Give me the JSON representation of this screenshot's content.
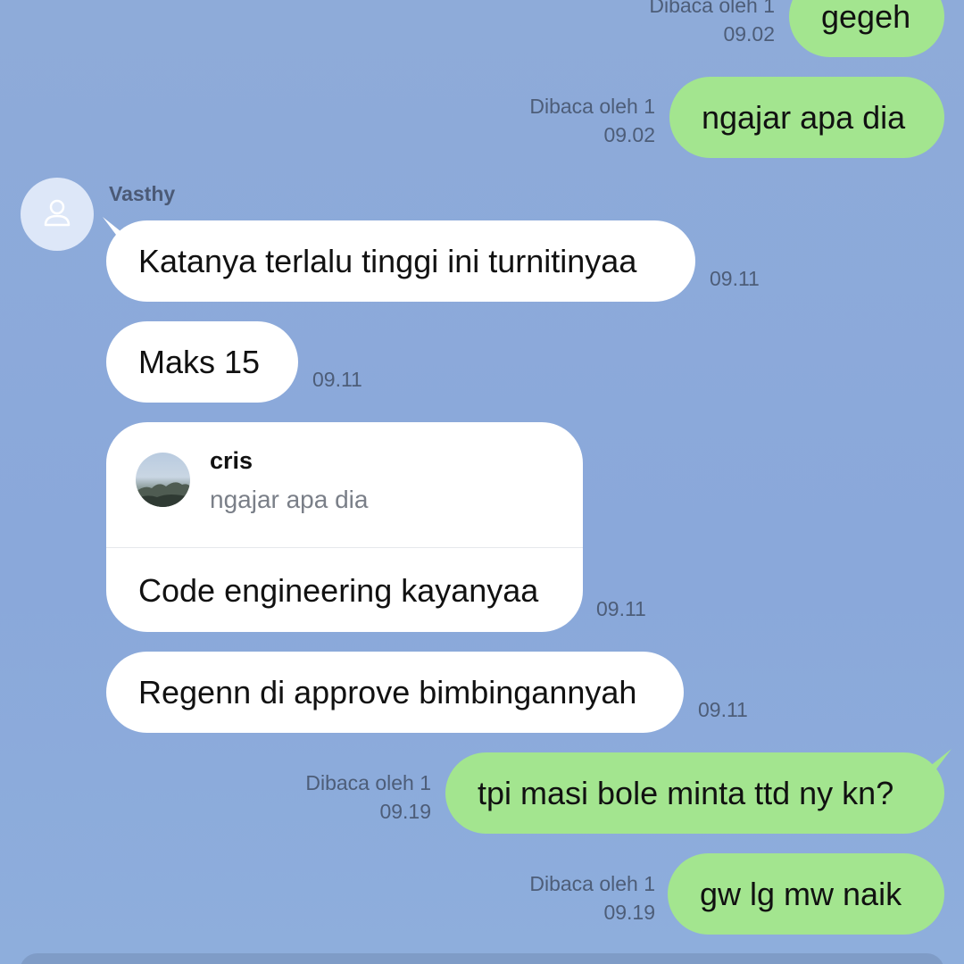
{
  "messages": [
    {
      "id": "m1",
      "text": "gegeh",
      "read": "Dibaca oleh 1",
      "time": "09.02"
    },
    {
      "id": "m2",
      "text": "ngajar apa dia",
      "read": "Dibaca oleh 1",
      "time": "09.02"
    },
    {
      "id": "m3",
      "sender": "Vasthy",
      "text": "Katanya terlalu tinggi ini turnitinyaa",
      "time": "09.11"
    },
    {
      "id": "m4",
      "text": "Maks 15",
      "time": "09.11"
    },
    {
      "id": "m5",
      "reply_to": {
        "author": "cris",
        "text": "ngajar apa dia"
      },
      "text": "Code engineering kayanyaa",
      "time": "09.11"
    },
    {
      "id": "m6",
      "text": "Regenn di approve bimbingannyah",
      "time": "09.11"
    },
    {
      "id": "m7",
      "text": "tpi masi bole minta ttd ny kn?",
      "read": "Dibaca oleh 1",
      "time": "09.19"
    },
    {
      "id": "m8",
      "text": "gw lg mw naik",
      "read": "Dibaca oleh 1",
      "time": "09.19"
    }
  ],
  "icons": {
    "contact_avatar": "person-icon",
    "reply_avatar": "profile-photo"
  },
  "colors": {
    "background": "#8eabd9",
    "outgoing_bubble": "#a3e58f",
    "incoming_bubble": "#ffffff"
  }
}
